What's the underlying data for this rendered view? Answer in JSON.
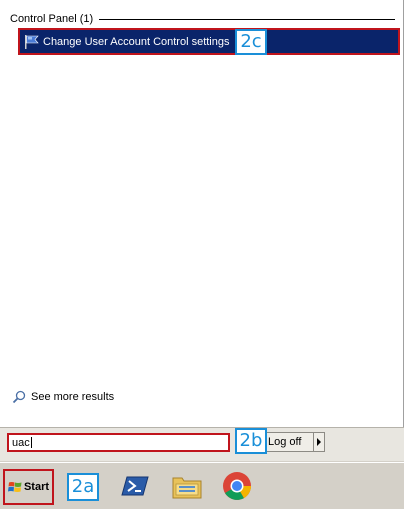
{
  "results": {
    "group_label": "Control Panel (1)",
    "item_label": "Change User Account Control settings",
    "see_more_label": "See more results"
  },
  "search": {
    "value": "uac"
  },
  "buttons": {
    "logoff_label": "Log off"
  },
  "taskbar": {
    "start_label": "Start"
  },
  "callouts": {
    "c2a": "2a",
    "c2b": "2b",
    "c2c": "2c"
  },
  "icons": {
    "uac_flag": "uac-shield-flag-icon",
    "search": "magnifier-icon",
    "windows_logo": "windows-logo-icon",
    "powershell": "powershell-icon",
    "explorer": "folder-icon",
    "chrome": "chrome-icon"
  },
  "colors": {
    "selection": "#0a246a",
    "annotation_red": "#c0141c",
    "callout_blue": "#1a8fd8"
  }
}
